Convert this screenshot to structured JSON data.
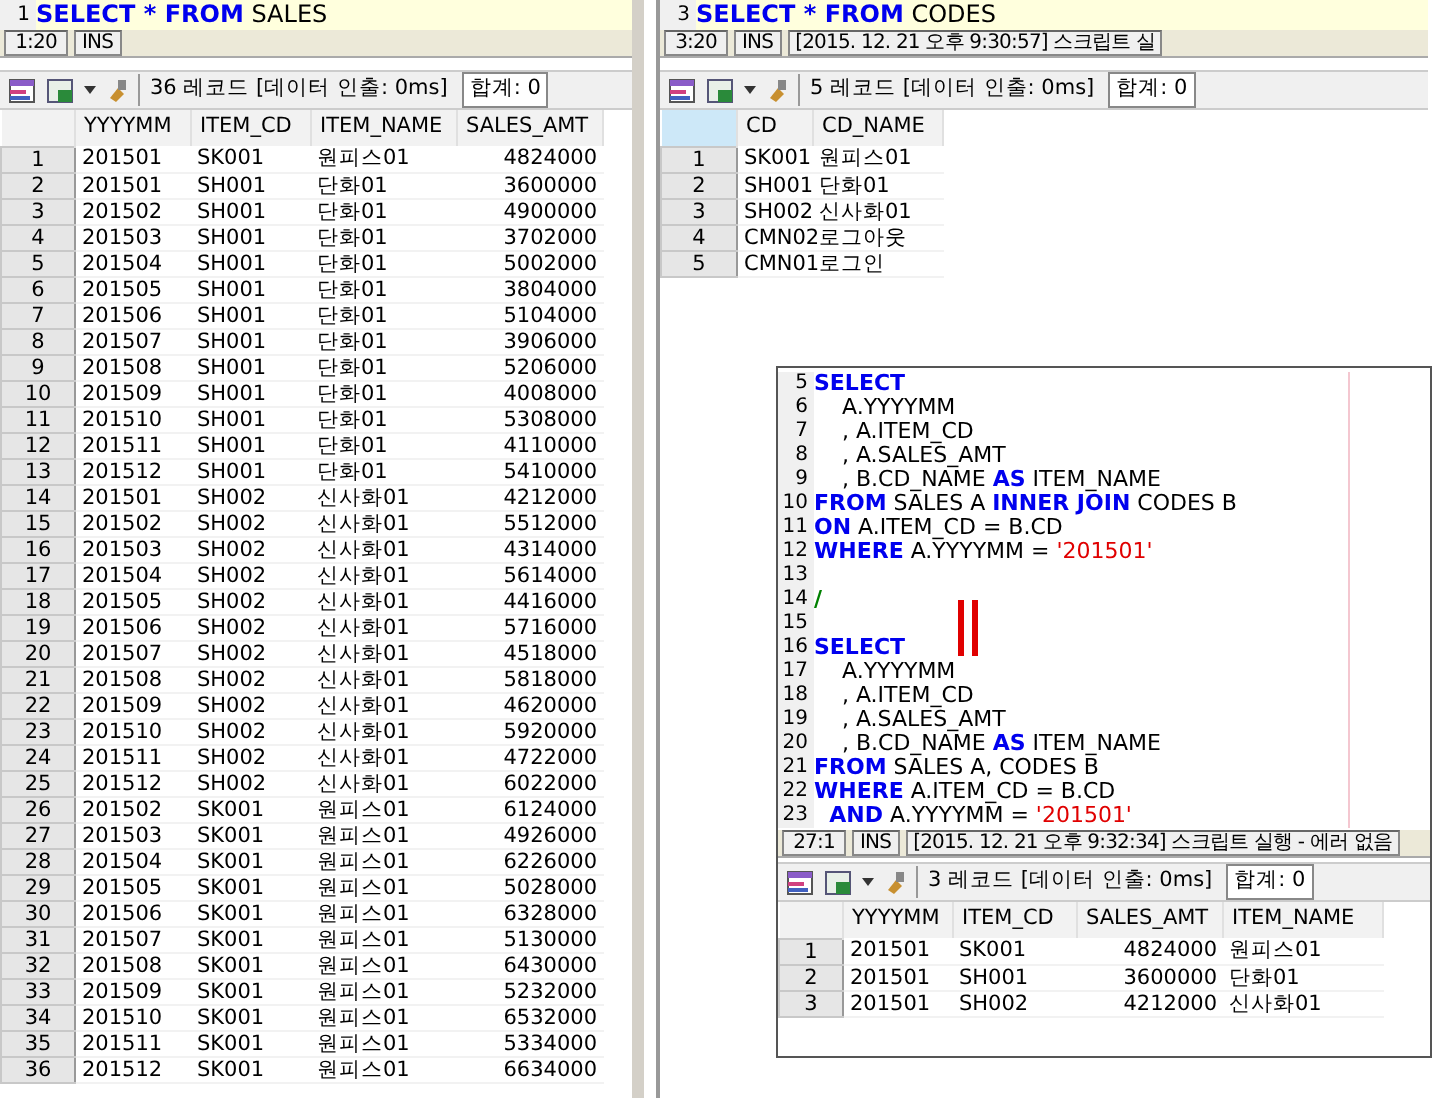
{
  "panes": [
    {
      "editor": {
        "lines": [
          {
            "number": "1",
            "current": true,
            "tokens": [
              {
                "kind": "keyword",
                "text": "SELECT"
              },
              {
                "kind": "keyword",
                "text": " *"
              },
              {
                "kind": "keyword",
                "text": " FROM"
              },
              {
                "kind": "plain",
                "text": " SALES"
              }
            ]
          }
        ]
      },
      "status_bar": {
        "position": "1:20",
        "mode": "INS"
      },
      "result": {
        "record_info": "36 레코드 [데이터 인출: 0ms]",
        "total": "합계: 0",
        "columns": [
          {
            "label": "YYYYMM",
            "kind": "text"
          },
          {
            "label": "ITEM_CD",
            "kind": "text"
          },
          {
            "label": "ITEM_NAME",
            "kind": "text"
          },
          {
            "label": "SALES_AMT",
            "kind": "number"
          }
        ],
        "rows": [
          {
            "number": "1",
            "cells": [
              "201501",
              "SK001",
              "원피스01",
              "4824000"
            ]
          },
          {
            "number": "2",
            "cells": [
              "201501",
              "SH001",
              "단화01",
              "3600000"
            ]
          },
          {
            "number": "3",
            "cells": [
              "201502",
              "SH001",
              "단화01",
              "4900000"
            ]
          },
          {
            "number": "4",
            "cells": [
              "201503",
              "SH001",
              "단화01",
              "3702000"
            ]
          },
          {
            "number": "5",
            "cells": [
              "201504",
              "SH001",
              "단화01",
              "5002000"
            ]
          },
          {
            "number": "6",
            "cells": [
              "201505",
              "SH001",
              "단화01",
              "3804000"
            ]
          },
          {
            "number": "7",
            "cells": [
              "201506",
              "SH001",
              "단화01",
              "5104000"
            ]
          },
          {
            "number": "8",
            "cells": [
              "201507",
              "SH001",
              "단화01",
              "3906000"
            ]
          },
          {
            "number": "9",
            "cells": [
              "201508",
              "SH001",
              "단화01",
              "5206000"
            ]
          },
          {
            "number": "10",
            "cells": [
              "201509",
              "SH001",
              "단화01",
              "4008000"
            ]
          },
          {
            "number": "11",
            "cells": [
              "201510",
              "SH001",
              "단화01",
              "5308000"
            ]
          },
          {
            "number": "12",
            "cells": [
              "201511",
              "SH001",
              "단화01",
              "4110000"
            ]
          },
          {
            "number": "13",
            "cells": [
              "201512",
              "SH001",
              "단화01",
              "5410000"
            ]
          },
          {
            "number": "14",
            "cells": [
              "201501",
              "SH002",
              "신사화01",
              "4212000"
            ]
          },
          {
            "number": "15",
            "cells": [
              "201502",
              "SH002",
              "신사화01",
              "5512000"
            ]
          },
          {
            "number": "16",
            "cells": [
              "201503",
              "SH002",
              "신사화01",
              "4314000"
            ]
          },
          {
            "number": "17",
            "cells": [
              "201504",
              "SH002",
              "신사화01",
              "5614000"
            ]
          },
          {
            "number": "18",
            "cells": [
              "201505",
              "SH002",
              "신사화01",
              "4416000"
            ]
          },
          {
            "number": "19",
            "cells": [
              "201506",
              "SH002",
              "신사화01",
              "5716000"
            ]
          },
          {
            "number": "20",
            "cells": [
              "201507",
              "SH002",
              "신사화01",
              "4518000"
            ]
          },
          {
            "number": "21",
            "cells": [
              "201508",
              "SH002",
              "신사화01",
              "5818000"
            ]
          },
          {
            "number": "22",
            "cells": [
              "201509",
              "SH002",
              "신사화01",
              "4620000"
            ]
          },
          {
            "number": "23",
            "cells": [
              "201510",
              "SH002",
              "신사화01",
              "5920000"
            ]
          },
          {
            "number": "24",
            "cells": [
              "201511",
              "SH002",
              "신사화01",
              "4722000"
            ]
          },
          {
            "number": "25",
            "cells": [
              "201512",
              "SH002",
              "신사화01",
              "6022000"
            ]
          },
          {
            "number": "26",
            "cells": [
              "201502",
              "SK001",
              "원피스01",
              "6124000"
            ]
          },
          {
            "number": "27",
            "cells": [
              "201503",
              "SK001",
              "원피스01",
              "4926000"
            ]
          },
          {
            "number": "28",
            "cells": [
              "201504",
              "SK001",
              "원피스01",
              "6226000"
            ]
          },
          {
            "number": "29",
            "cells": [
              "201505",
              "SK001",
              "원피스01",
              "5028000"
            ]
          },
          {
            "number": "30",
            "cells": [
              "201506",
              "SK001",
              "원피스01",
              "6328000"
            ]
          },
          {
            "number": "31",
            "cells": [
              "201507",
              "SK001",
              "원피스01",
              "5130000"
            ]
          },
          {
            "number": "32",
            "cells": [
              "201508",
              "SK001",
              "원피스01",
              "6430000"
            ]
          },
          {
            "number": "33",
            "cells": [
              "201509",
              "SK001",
              "원피스01",
              "5232000"
            ]
          },
          {
            "number": "34",
            "cells": [
              "201510",
              "SK001",
              "원피스01",
              "6532000"
            ]
          },
          {
            "number": "35",
            "cells": [
              "201511",
              "SK001",
              "원피스01",
              "5334000"
            ]
          },
          {
            "number": "36",
            "cells": [
              "201512",
              "SK001",
              "원피스01",
              "6634000"
            ]
          }
        ]
      }
    },
    {
      "editor": {
        "lines": [
          {
            "number": "3",
            "current": true,
            "tokens": [
              {
                "kind": "keyword",
                "text": "SELECT"
              },
              {
                "kind": "keyword",
                "text": " *"
              },
              {
                "kind": "keyword",
                "text": " FROM"
              },
              {
                "kind": "plain",
                "text": " CODES"
              }
            ]
          }
        ]
      },
      "status_bar": {
        "position": "3:20",
        "mode": "INS",
        "message": "[2015. 12. 21 오후 9:30:57] 스크립트 실"
      },
      "result": {
        "record_info": "5 레코드 [데이터 인출: 0ms]",
        "total": "합계: 0",
        "columns": [
          {
            "label": "CD",
            "kind": "text"
          },
          {
            "label": "CD_NAME",
            "kind": "text"
          }
        ],
        "rows": [
          {
            "number": "1",
            "cells": [
              "SK001",
              "원피스01"
            ]
          },
          {
            "number": "2",
            "cells": [
              "SH001",
              "단화01"
            ]
          },
          {
            "number": "3",
            "cells": [
              "SH002",
              "신사화01"
            ]
          },
          {
            "number": "4",
            "cells": [
              "CMN02",
              "로그아웃"
            ]
          },
          {
            "number": "5",
            "cells": [
              "CMN01",
              "로그인"
            ]
          }
        ]
      }
    },
    {
      "editor": {
        "lines": [
          {
            "number": "5",
            "current": false,
            "tokens": [
              {
                "kind": "keyword",
                "text": "SELECT"
              }
            ]
          },
          {
            "number": "6",
            "current": false,
            "tokens": [
              {
                "kind": "plain",
                "text": "    A.YYYYMM"
              }
            ]
          },
          {
            "number": "7",
            "current": false,
            "tokens": [
              {
                "kind": "plain",
                "text": "    , A.ITEM_CD"
              }
            ]
          },
          {
            "number": "8",
            "current": false,
            "tokens": [
              {
                "kind": "plain",
                "text": "    , A.SALES_AMT"
              }
            ]
          },
          {
            "number": "9",
            "current": false,
            "tokens": [
              {
                "kind": "plain",
                "text": "    , B.CD_NAME "
              },
              {
                "kind": "keyword",
                "text": "AS"
              },
              {
                "kind": "plain",
                "text": " ITEM_NAME"
              }
            ]
          },
          {
            "number": "10",
            "current": false,
            "tokens": [
              {
                "kind": "keyword",
                "text": "FROM"
              },
              {
                "kind": "plain",
                "text": " SALES A "
              },
              {
                "kind": "keyword",
                "text": "INNER JOIN"
              },
              {
                "kind": "plain",
                "text": " CODES B"
              }
            ]
          },
          {
            "number": "11",
            "current": false,
            "tokens": [
              {
                "kind": "keyword",
                "text": "ON"
              },
              {
                "kind": "plain",
                "text": " A.ITEM_CD = B.CD"
              }
            ]
          },
          {
            "number": "12",
            "current": false,
            "tokens": [
              {
                "kind": "keyword",
                "text": "WHERE"
              },
              {
                "kind": "plain",
                "text": " A.YYYYMM = "
              },
              {
                "kind": "string",
                "text": "'201501'"
              }
            ]
          },
          {
            "number": "13",
            "current": false
          },
          {
            "number": "14",
            "current": false,
            "tokens": [
              {
                "kind": "comment",
                "text": "/"
              }
            ]
          },
          {
            "number": "15",
            "current": false
          },
          {
            "number": "16",
            "current": false,
            "tokens": [
              {
                "kind": "keyword",
                "text": "SELECT"
              }
            ]
          },
          {
            "number": "17",
            "current": false,
            "tokens": [
              {
                "kind": "plain",
                "text": "    A.YYYYMM"
              }
            ]
          },
          {
            "number": "18",
            "current": false,
            "tokens": [
              {
                "kind": "plain",
                "text": "    , A.ITEM_CD"
              }
            ]
          },
          {
            "number": "19",
            "current": false,
            "tokens": [
              {
                "kind": "plain",
                "text": "    , A.SALES_AMT"
              }
            ]
          },
          {
            "number": "20",
            "current": false,
            "tokens": [
              {
                "kind": "plain",
                "text": "    , B.CD_NAME "
              },
              {
                "kind": "keyword",
                "text": "AS"
              },
              {
                "kind": "plain",
                "text": " ITEM_NAME"
              }
            ]
          },
          {
            "number": "21",
            "current": false,
            "tokens": [
              {
                "kind": "keyword",
                "text": "FROM"
              },
              {
                "kind": "plain",
                "text": " SALES A, CODES B"
              }
            ]
          },
          {
            "number": "22",
            "current": false,
            "tokens": [
              {
                "kind": "keyword",
                "text": "WHERE"
              },
              {
                "kind": "plain",
                "text": " A.ITEM_CD = B.CD"
              }
            ]
          },
          {
            "number": "23",
            "current": false,
            "tokens": [
              {
                "kind": "keyword",
                "text": "  AND"
              },
              {
                "kind": "plain",
                "text": " A.YYYYMM = "
              },
              {
                "kind": "string",
                "text": "'201501'"
              }
            ]
          }
        ]
      },
      "status_bar": {
        "position": "27:1",
        "mode": "INS",
        "message": "[2015. 12. 21 오후 9:32:34] 스크립트 실행 - 에러 없음"
      },
      "result": {
        "record_info": "3 레코드 [데이터 인출: 0ms]",
        "total": "합계: 0",
        "columns": [
          {
            "label": "YYYYMM",
            "kind": "text"
          },
          {
            "label": "ITEM_CD",
            "kind": "text"
          },
          {
            "label": "SALES_AMT",
            "kind": "number"
          },
          {
            "label": "ITEM_NAME",
            "kind": "text"
          }
        ],
        "rows": [
          {
            "number": "1",
            "cells": [
              "201501",
              "SK001",
              "4824000",
              "원피스01"
            ]
          },
          {
            "number": "2",
            "cells": [
              "201501",
              "SH001",
              "3600000",
              "단화01"
            ]
          },
          {
            "number": "3",
            "cells": [
              "201501",
              "SH002",
              "4212000",
              "신사화01"
            ]
          }
        ]
      }
    }
  ]
}
